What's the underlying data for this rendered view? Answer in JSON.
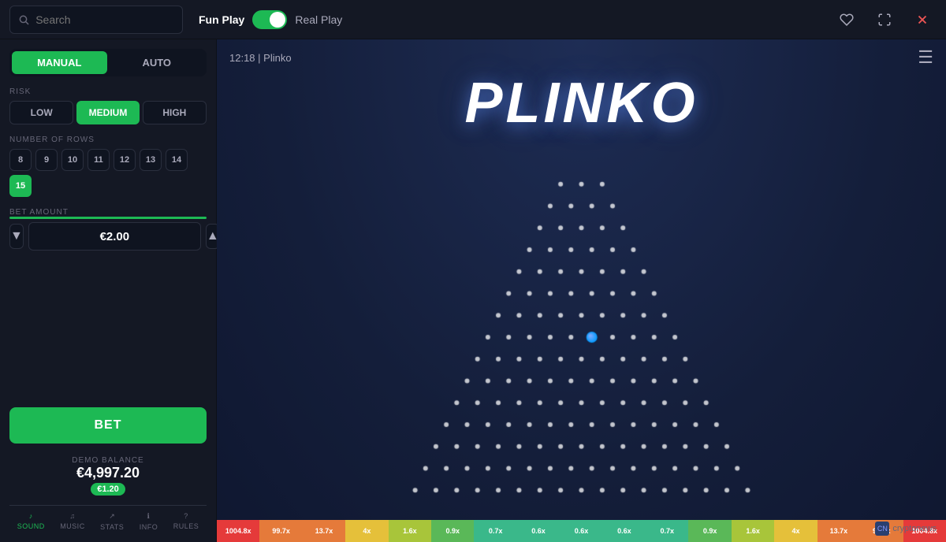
{
  "header": {
    "search_placeholder": "Search",
    "fun_play_label": "Fun Play",
    "real_play_label": "Real Play",
    "toggle_state": "fun"
  },
  "sidebar": {
    "manual_label": "Manual",
    "auto_label": "Auto",
    "risk_label": "RISK",
    "risk_options": [
      "LOW",
      "MEDIUM",
      "HIGH"
    ],
    "risk_active": "MEDIUM",
    "rows_label": "NUMBER OF ROWS",
    "rows_options": [
      8,
      9,
      10,
      11,
      12,
      13,
      14,
      15
    ],
    "rows_active": 15,
    "bet_amount_label": "BET AMOUNT",
    "bet_value": "€2.00",
    "bet_button_label": "BET",
    "demo_balance_label": "DEMO BALANCE",
    "demo_balance_amount": "€4,997.20",
    "demo_chip_label": "€1.20"
  },
  "footer_icons": [
    {
      "label": "SOUND",
      "icon": "♪",
      "active": true
    },
    {
      "label": "MUSIC",
      "icon": "♫",
      "active": false
    },
    {
      "label": "STATS",
      "icon": "↗",
      "active": false
    },
    {
      "label": "INFO",
      "icon": "ℹ",
      "active": false
    },
    {
      "label": "RULES",
      "icon": "?",
      "active": false
    }
  ],
  "game": {
    "time": "12:18",
    "title_separator": "|",
    "game_name": "Plinko",
    "plinko_title": "PLINKO",
    "rows": 15,
    "ball_col": 9,
    "ball_row": 8
  },
  "multipliers": [
    {
      "value": "1004.8x",
      "color": "red"
    },
    {
      "value": "99.7x",
      "color": "orange"
    },
    {
      "value": "13.7x",
      "color": "orange"
    },
    {
      "value": "4x",
      "color": "yellow"
    },
    {
      "value": "1.6x",
      "color": "lime"
    },
    {
      "value": "0.9x",
      "color": "green"
    },
    {
      "value": "0.7x",
      "color": "teal"
    },
    {
      "value": "0.6x",
      "color": "teal"
    },
    {
      "value": "0.6x",
      "color": "teal"
    },
    {
      "value": "0.6x",
      "color": "teal"
    },
    {
      "value": "0.7x",
      "color": "teal"
    },
    {
      "value": "0.9x",
      "color": "green"
    },
    {
      "value": "1.6x",
      "color": "lime"
    },
    {
      "value": "4x",
      "color": "yellow"
    },
    {
      "value": "13.7x",
      "color": "orange"
    },
    {
      "value": "99.7x",
      "color": "orange"
    },
    {
      "value": "1004.8x",
      "color": "red"
    }
  ],
  "watermark": "cryptonews"
}
